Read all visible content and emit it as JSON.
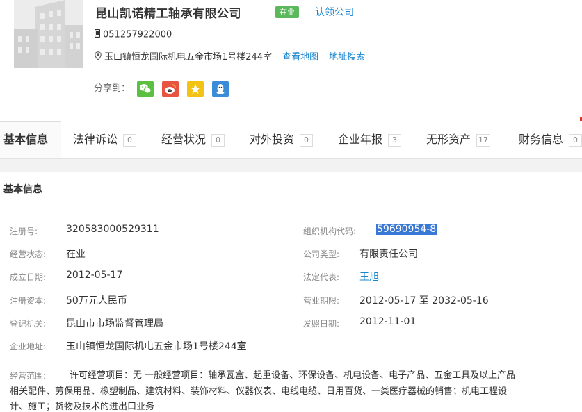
{
  "company": {
    "name": "昆山凯诺精工轴承有限公司",
    "status": "在业",
    "claim_label": "认领公司",
    "phone": "051257922000",
    "address": "玉山镇恒龙国际机电五金市场1号楼244室",
    "map_label": "查看地图",
    "addr_search_label": "地址搜索",
    "share_label": "分享到："
  },
  "tabs": [
    {
      "label": "基本信息",
      "count": ""
    },
    {
      "label": "法律诉讼",
      "count": "0"
    },
    {
      "label": "经营状况",
      "count": "0"
    },
    {
      "label": "对外投资",
      "count": "0"
    },
    {
      "label": "企业年报",
      "count": "3"
    },
    {
      "label": "无形资产",
      "count": "17"
    },
    {
      "label": "财务信息",
      "count": "0"
    }
  ],
  "section": {
    "title": "基本信息"
  },
  "info": {
    "reg_no_label": "注册号:",
    "reg_no": "320583000529311",
    "org_code_label": "组织机构代码:",
    "org_code": "59690954-8",
    "op_status_label": "经营状态:",
    "op_status": "在业",
    "company_type_label": "公司类型:",
    "company_type": "有限责任公司",
    "founded_label": "成立日期:",
    "founded": "2012-05-17",
    "legal_rep_label": "法定代表:",
    "legal_rep": "王旭",
    "capital_label": "注册资本:",
    "capital": "50万元人民币",
    "term_label": "营业期限:",
    "term": "2012-05-17 至 2032-05-16",
    "authority_label": "登记机关:",
    "authority": "昆山市市场监督管理局",
    "issue_date_label": "发照日期:",
    "issue_date": "2012-11-01",
    "address_label": "企业地址:",
    "address": "玉山镇恒龙国际机电五金市场1号楼244室",
    "scope_label": "经营范围:",
    "scope_line1": "许可经营项目：无 一般经营项目：轴承瓦盒、起重设备、环保设备、机电设备、电子产品、五金工具及以上产品",
    "scope_line2": "相关配件、劳保用品、橡塑制品、建筑材料、装饰材料、仪器仪表、电线电缆、日用百货、一类医疗器械的销售；机电工程设",
    "scope_line3": "计、施工；货物及技术的进出口业务"
  },
  "colors": {
    "link": "#1a86d0",
    "status_green": "#5cb85c",
    "wechat": "#5bbf3f",
    "weibo": "#e8543f",
    "qzone": "#f2c315",
    "qq": "#3a8bd8"
  }
}
